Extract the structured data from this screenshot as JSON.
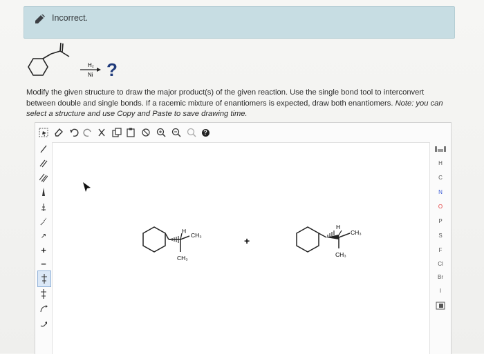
{
  "feedback": {
    "status_text": "Incorrect.",
    "icon": "pencil-icon"
  },
  "reaction": {
    "reagent_top": "H₂",
    "reagent_bottom": "Ni",
    "product_placeholder": "?"
  },
  "question": {
    "instruction": "Modify the given structure to draw the major product(s) of the given reaction. Use the single bond tool to interconvert between double and single bonds. If a racemic mixture of enantiomers is expected, draw both enantiomers.",
    "note": "Note: you can select a structure and use Copy and Paste to save drawing time."
  },
  "toolbar": {
    "tools": [
      "select-lasso-icon",
      "eraser-icon",
      "undo-icon",
      "redo-icon",
      "cut-icon",
      "copy-icon",
      "paste-icon",
      "clean-icon",
      "zoom-in-icon",
      "zoom-out-icon",
      "zoom-reset-icon",
      "help-icon"
    ],
    "help_label": "?"
  },
  "left_tools": [
    "single-bond-icon",
    "double-bond-icon",
    "triple-bond-icon",
    "wedge-bond-icon",
    "hash-bond-icon",
    "wavy-bond-icon",
    "chain-icon",
    "charge-plus-icon",
    "charge-minus-icon",
    "ring-template-icon",
    "add-atom-plus-icon",
    "electron-arrow-icon",
    "curved-arrow-icon"
  ],
  "left_labels": {
    "chain": "↗",
    "charge_plus": "+",
    "charge_minus": "−"
  },
  "elements": [
    "H",
    "C",
    "N",
    "O",
    "P",
    "S",
    "F",
    "Cl",
    "Br",
    "I"
  ],
  "elements_colors": {
    "O": "#e23b3b",
    "N": "#3b5bd6"
  },
  "canvas": {
    "plus": "+",
    "mol1": {
      "h_label": "H",
      "ch3_right": "CH₃",
      "ch3_down": "CH₃"
    },
    "mol2": {
      "h_label": "H",
      "ch3_right": "CH₃",
      "ch3_down": "CH₃"
    }
  }
}
